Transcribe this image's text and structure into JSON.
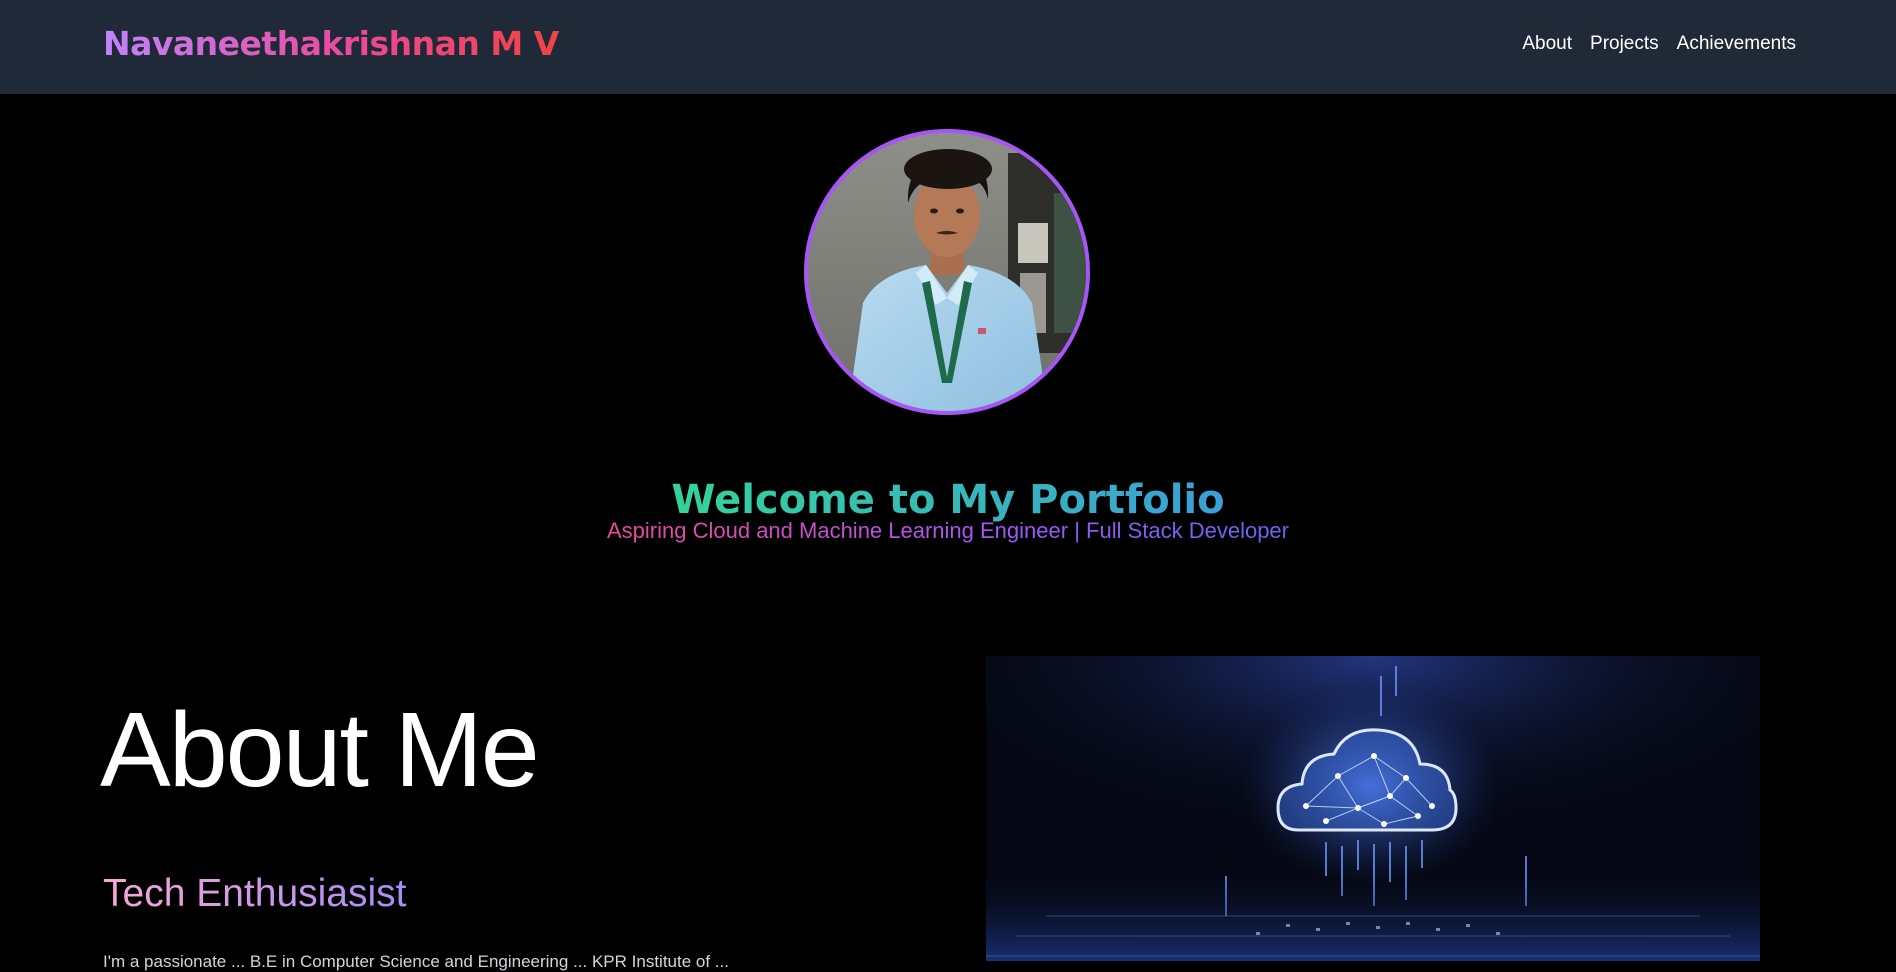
{
  "navbar": {
    "brand": "Navaneethakrishnan M V",
    "links": [
      {
        "label": "About"
      },
      {
        "label": "Projects"
      },
      {
        "label": "Achievements"
      }
    ]
  },
  "hero": {
    "title": "Welcome to My Portfolio",
    "subtitle": "Aspiring Cloud and Machine Learning Engineer | Full Stack Developer"
  },
  "about": {
    "heading": "About Me",
    "subheading": "Tech Enthusiasist",
    "body_preview": "I'm a passionate ... B.E in Computer Science and Engineering ... KPR Institute of ..."
  },
  "colors": {
    "navbar_bg": "#1f2937",
    "page_bg": "#000000",
    "avatar_border": "#a855f7",
    "brand_gradient_start": "#c084fc",
    "brand_gradient_end": "#ef4444",
    "title_gradient_start": "#34d399",
    "title_gradient_end": "#3b9fd6"
  },
  "icons": {
    "profile_photo": "profile-photo",
    "cloud_image": "cloud-network-illustration"
  }
}
